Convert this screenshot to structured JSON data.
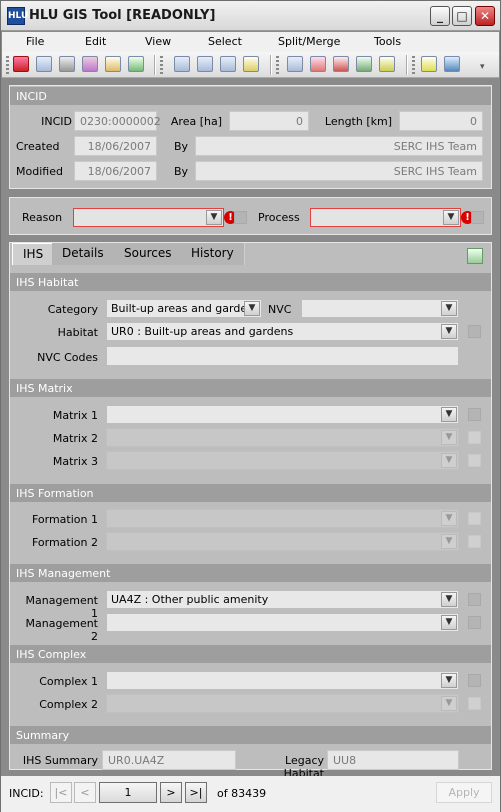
{
  "window": {
    "title": "HLU GIS Tool [READONLY]",
    "icon_text": "HLU"
  },
  "menu": [
    "File",
    "Edit",
    "View",
    "Select",
    "Split/Merge",
    "Tools"
  ],
  "incid_section": {
    "header": "INCID",
    "incid_label": "INCID",
    "incid_value": "0230:0000002",
    "area_label": "Area [ha]",
    "area_value": "0",
    "length_label": "Length [km]",
    "length_value": "0",
    "created_label": "Created",
    "created_value": "18/06/2007",
    "created_by_label": "By",
    "created_by_value": "SERC IHS Team",
    "modified_label": "Modified",
    "modified_value": "18/06/2007",
    "modified_by_label": "By",
    "modified_by_value": "SERC IHS Team"
  },
  "reason_section": {
    "reason_label": "Reason",
    "process_label": "Process",
    "error_mark": "!"
  },
  "tabs": [
    "IHS",
    "Details",
    "Sources",
    "History"
  ],
  "ihs_habitat": {
    "header": "IHS Habitat",
    "category_label": "Category",
    "category_value": "Built-up areas and gardens",
    "nvc_label": "NVC",
    "habitat_label": "Habitat",
    "habitat_value": "UR0 : Built-up areas and gardens",
    "nvc_codes_label": "NVC Codes"
  },
  "ihs_matrix": {
    "header": "IHS Matrix",
    "labels": [
      "Matrix 1",
      "Matrix 2",
      "Matrix 3"
    ]
  },
  "ihs_formation": {
    "header": "IHS Formation",
    "labels": [
      "Formation 1",
      "Formation 2"
    ]
  },
  "ihs_management": {
    "header": "IHS Management",
    "management1_label": "Management 1",
    "management1_value": "UA4Z : Other public amenity",
    "management2_label": "Management 2"
  },
  "ihs_complex": {
    "header": "IHS Complex",
    "labels": [
      "Complex 1",
      "Complex 2"
    ]
  },
  "summary": {
    "header": "Summary",
    "ihs_summary_label": "IHS Summary",
    "ihs_summary_value": "UR0.UA4Z",
    "legacy_label": "Legacy Habitat",
    "legacy_value": "UU8"
  },
  "footer": {
    "incid_label": "INCID:",
    "first": "|<",
    "prev": "<",
    "current": "1",
    "next": ">",
    "last": ">|",
    "of_text": "of 83439",
    "apply_label": "Apply"
  }
}
